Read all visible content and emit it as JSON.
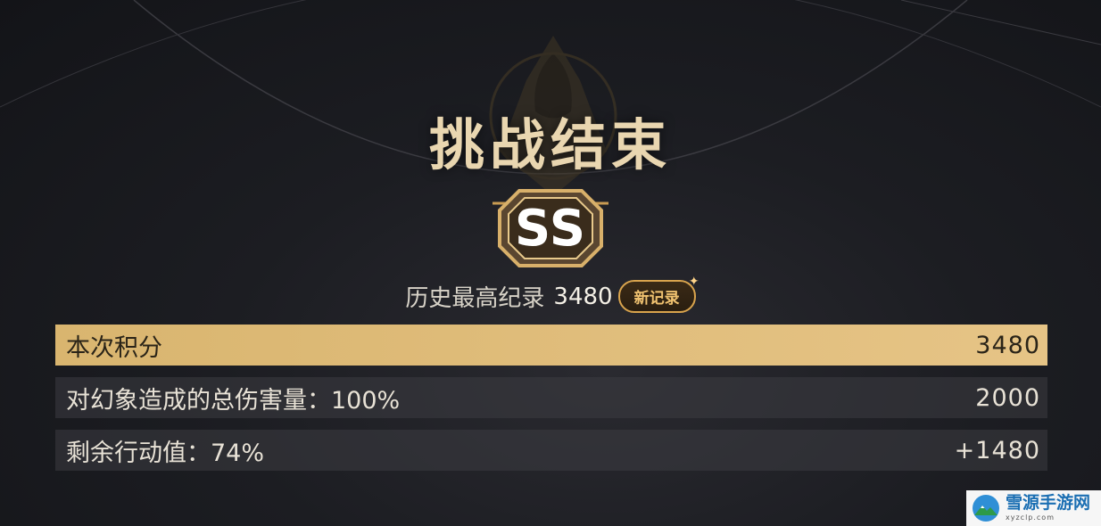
{
  "title": "挑战结束",
  "rank": "SS",
  "best_record": {
    "label": "历史最高纪录",
    "value": "3480",
    "badge": "新记录"
  },
  "score_rows": [
    {
      "label": "本次积分",
      "value": "3480"
    },
    {
      "label": "对幻象造成的总伤害量：100%",
      "value": "2000"
    },
    {
      "label": "剩余行动值：74%",
      "value": "+1480"
    }
  ],
  "watermark": {
    "cn": "雪源手游网",
    "en": "xyzclp.com"
  },
  "colors": {
    "accent_gold": "#d9b56f",
    "title_gold": "#e9d6b0",
    "badge_border": "#d9a44d",
    "row_bg": "#3c3c42"
  }
}
